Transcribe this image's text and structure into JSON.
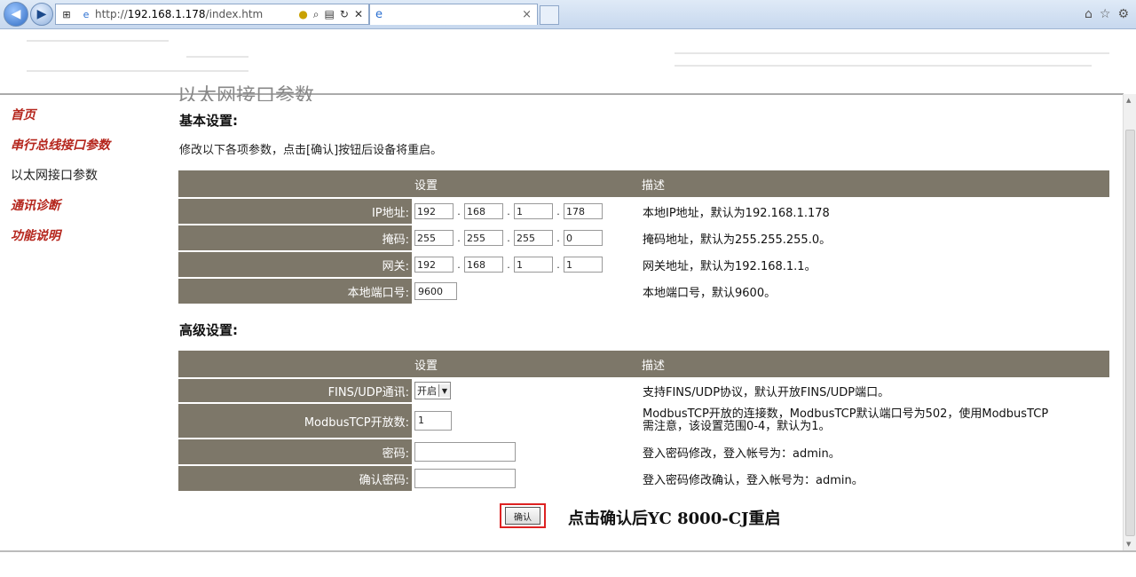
{
  "browser": {
    "url_prefix": "http://",
    "url_host": "192.168.1.178",
    "url_path": "/index.htm",
    "tab_close": "×"
  },
  "sidebar": {
    "items": [
      {
        "label": "首页",
        "active": false
      },
      {
        "label": "串行总线接口参数",
        "active": false
      },
      {
        "label": "以太网接口参数",
        "active": true
      },
      {
        "label": "通讯诊断",
        "active": false
      },
      {
        "label": "功能说明",
        "active": false
      }
    ]
  },
  "main": {
    "page_title": "以太网接口参数",
    "basic_title": "基本设置:",
    "notice": "修改以下各项参数，点击[确认]按钮后设备将重启。",
    "col_setting": "设置",
    "col_desc": "描述",
    "basic_rows": [
      {
        "label": "IP地址:",
        "values": [
          "192",
          "168",
          "1",
          "178"
        ],
        "desc": "本地IP地址，默认为192.168.1.178"
      },
      {
        "label": "掩码:",
        "values": [
          "255",
          "255",
          "255",
          "0"
        ],
        "desc": "掩码地址，默认为255.255.255.0。"
      },
      {
        "label": "网关:",
        "values": [
          "192",
          "168",
          "1",
          "1"
        ],
        "desc": "网关地址，默认为192.168.1.1。"
      },
      {
        "label": "本地端口号:",
        "value": "9600",
        "desc": "本地端口号，默认9600。"
      }
    ],
    "advanced_title": "高级设置:",
    "advanced_rows": [
      {
        "label": "FINS/UDP通讯:",
        "value": "开启",
        "desc": "支持FINS/UDP协议，默认开放FINS/UDP端口。"
      },
      {
        "label": "ModbusTCP开放数:",
        "value": "1",
        "desc_line1": "ModbusTCP开放的连接数，ModbusTCP默认端口号为502，使用ModbusTCP",
        "desc_line2": "需注意，该设置范围0-4，默认为1。"
      },
      {
        "label": "密码:",
        "value": "",
        "desc": "登入密码修改，登入帐号为：admin。"
      },
      {
        "label": "确认密码:",
        "value": "",
        "desc": "登入密码修改确认，登入帐号为：admin。"
      }
    ],
    "confirm_label": "确认",
    "confirm_note": "点击确认后YC 8000-CJ重启"
  },
  "colors": {
    "header_bg": "#7d7769",
    "link_red": "#b5261d",
    "highlight_border": "#dd2222"
  }
}
